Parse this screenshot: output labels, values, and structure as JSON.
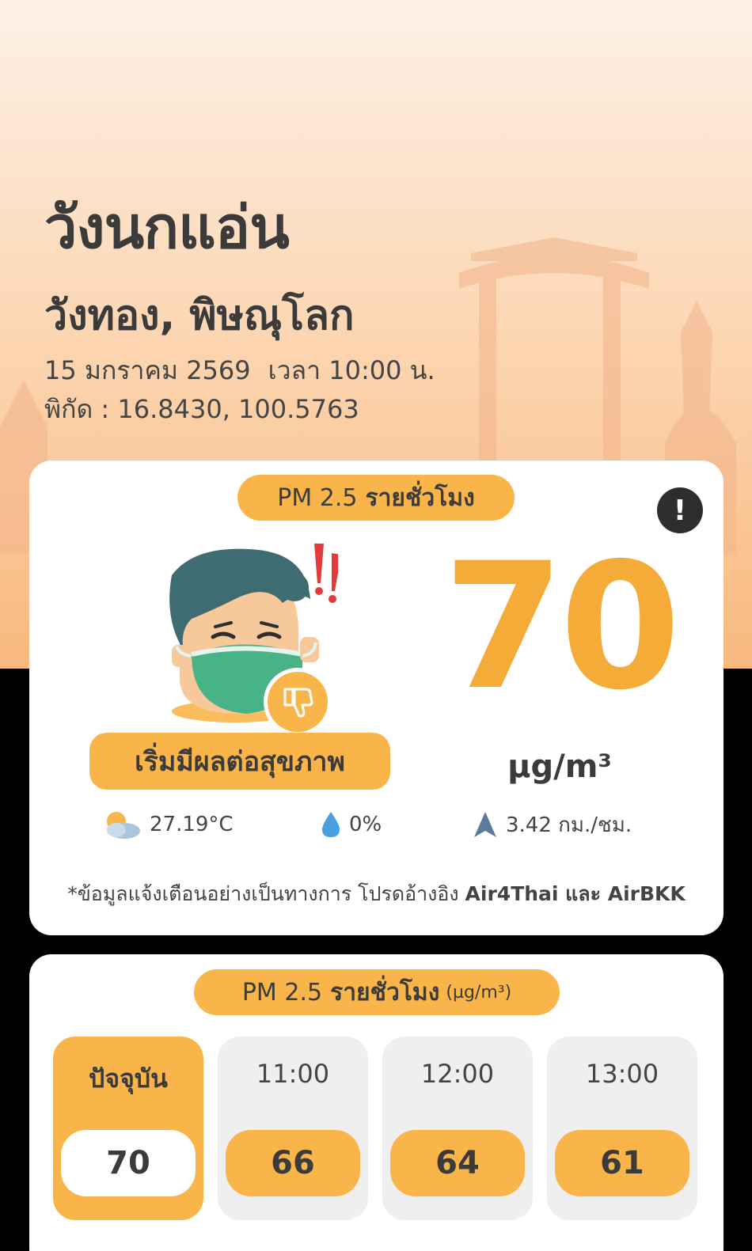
{
  "location": {
    "name": "วังนกแอ่น",
    "district": "วังทอง, พิษณุโลก",
    "date": "15 มกราคม 2569",
    "time": "เวลา 10:00 น.",
    "coordinates": "พิกัด : 16.8430, 100.5763"
  },
  "main_card": {
    "title_prefix": "PM 2.5",
    "title_bold": "รายชั่วโมง",
    "info_icon": "!",
    "status": "เริ่มมีผลต่อสุขภาพ",
    "pm_value": "70",
    "pm_unit": "µg/m³",
    "temperature": "27.19°C",
    "rain": "0%",
    "wind": "3.42 กม./ชม.",
    "disclaimer_text": "*ข้อมูลแจ้งเตือนอย่างเป็นทางการ โปรดอ้างอิง",
    "disclaimer_bold": "Air4Thai และ AirBKK",
    "icons": {
      "weather": "partly-cloudy-icon",
      "rain": "water-drop-icon",
      "wind": "wind-direction-icon",
      "status": "thumbs-down-icon"
    }
  },
  "hourly_card": {
    "title_prefix": "PM 2.5",
    "title_bold": "รายชั่วโมง",
    "title_unit": "(µg/m³)",
    "items": [
      {
        "label": "ปัจจุบัน",
        "value": "70"
      },
      {
        "label": "11:00",
        "value": "66"
      },
      {
        "label": "12:00",
        "value": "64"
      },
      {
        "label": "13:00",
        "value": "61"
      }
    ]
  },
  "colors": {
    "accent": "#f9b54a",
    "pm_value": "#f5ab38",
    "text_dark": "#3b3b3b",
    "card_bg": "#ffffff"
  }
}
